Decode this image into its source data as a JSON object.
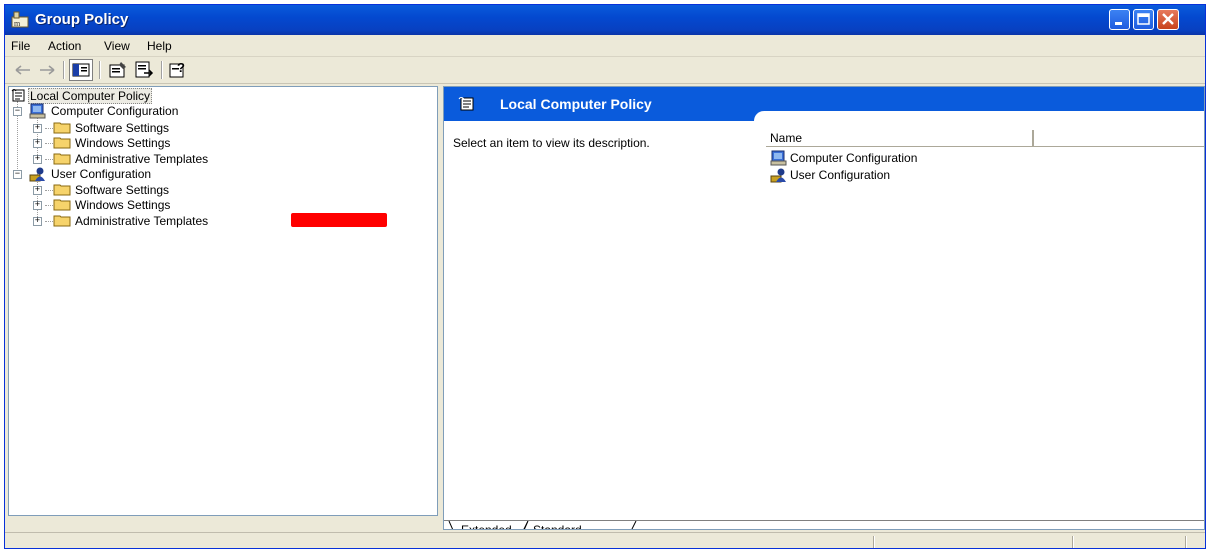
{
  "window": {
    "title": "Group Policy"
  },
  "menu": [
    {
      "label": "File"
    },
    {
      "label": "Action"
    },
    {
      "label": "View"
    },
    {
      "label": "Help"
    }
  ],
  "toolbar": {
    "buttons": [
      "back-arrow-icon",
      "forward-arrow-icon",
      "show-hide-tree-icon",
      "properties-icon",
      "export-list-icon",
      "help-icon"
    ]
  },
  "tree": {
    "root": "Local Computer Policy",
    "computer": {
      "label": "Computer Configuration",
      "children": [
        "Software Settings",
        "Windows Settings",
        "Administrative Templates"
      ]
    },
    "user": {
      "label": "User Configuration",
      "children": [
        "Software Settings",
        "Windows Settings",
        "Administrative Templates"
      ]
    }
  },
  "details": {
    "title": "Local Computer Policy",
    "description": "Select an item to view its description.",
    "column_name": "Name",
    "items": [
      "Computer Configuration",
      "User Configuration"
    ]
  },
  "tabs": [
    "Extended",
    "Standard"
  ],
  "colors": {
    "titlebar": "#0a5bdc",
    "banner": "#0a5bdc",
    "redaction": "#ff0000",
    "window_face": "#ece9d8"
  }
}
